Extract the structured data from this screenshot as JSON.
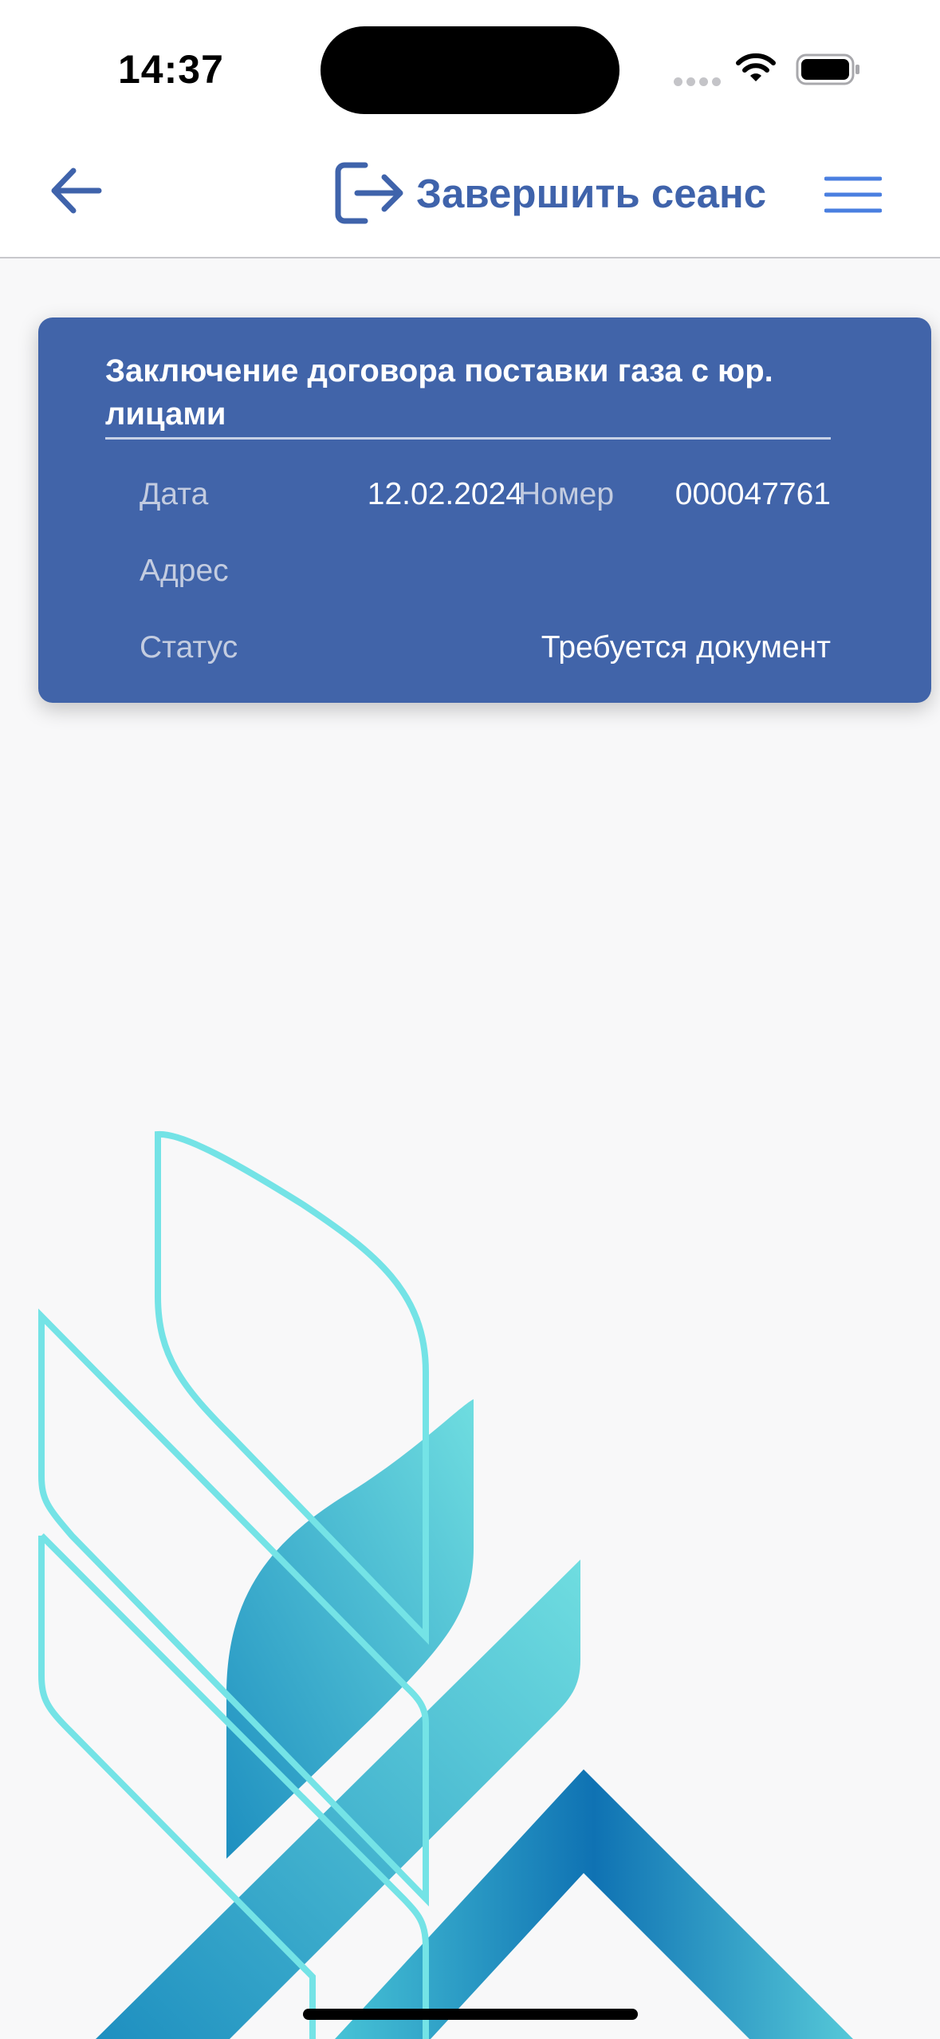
{
  "status_bar": {
    "time": "14:37"
  },
  "header": {
    "logout_label": "Завершить сеанс"
  },
  "card": {
    "title": "Заключение договора поставки газа с юр. лицами",
    "date_label": "Дата",
    "date_value": "12.02.2024",
    "number_label": "Номер",
    "number_value": "000047761",
    "address_label": "Адрес",
    "address_value": "",
    "status_label": "Статус",
    "status_value": "Требуется документ"
  },
  "colors": {
    "accent": "#3f63ab",
    "card_bg": "#4164a9",
    "menu_icon": "#4a7fe0",
    "deco_outline": "#74e3e6",
    "deco_fill_light": "#6bd8dd",
    "deco_fill_dark": "#1176b5"
  },
  "icons": [
    "arrow-left-icon",
    "logout-icon",
    "menu-icon",
    "wifi-icon",
    "battery-icon"
  ]
}
